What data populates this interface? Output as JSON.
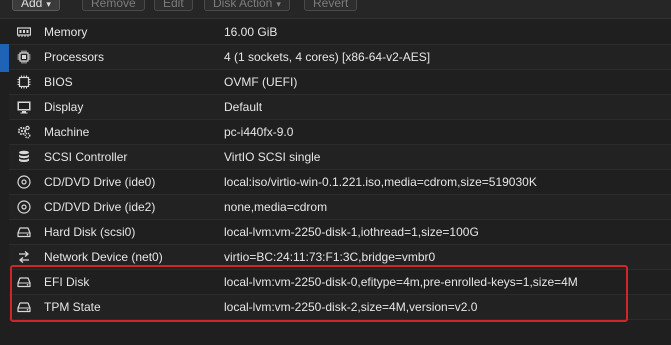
{
  "toolbar": {
    "buttons": [
      {
        "label": "Add",
        "enabled": true
      },
      {
        "label": "Remove",
        "enabled": false
      },
      {
        "label": "Edit",
        "enabled": false
      },
      {
        "label": "Disk Action",
        "enabled": false
      },
      {
        "label": "Revert",
        "enabled": false
      }
    ]
  },
  "hardware": {
    "rows": [
      {
        "icon": "memory-icon",
        "label": "Memory",
        "value": "16.00 GiB"
      },
      {
        "icon": "cpu-icon",
        "label": "Processors",
        "value": "4 (1 sockets, 4 cores) [x86-64-v2-AES]"
      },
      {
        "icon": "chip-icon",
        "label": "BIOS",
        "value": "OVMF (UEFI)"
      },
      {
        "icon": "monitor-icon",
        "label": "Display",
        "value": "Default"
      },
      {
        "icon": "gears-icon",
        "label": "Machine",
        "value": "pc-i440fx-9.0"
      },
      {
        "icon": "database-icon",
        "label": "SCSI Controller",
        "value": "VirtIO SCSI single"
      },
      {
        "icon": "disc-icon",
        "label": "CD/DVD Drive (ide0)",
        "value": "local:iso/virtio-win-0.1.221.iso,media=cdrom,size=519030K"
      },
      {
        "icon": "disc-icon",
        "label": "CD/DVD Drive (ide2)",
        "value": "none,media=cdrom"
      },
      {
        "icon": "hdd-icon",
        "label": "Hard Disk (scsi0)",
        "value": "local-lvm:vm-2250-disk-1,iothread=1,size=100G"
      },
      {
        "icon": "network-icon",
        "label": "Network Device (net0)",
        "value": "virtio=BC:24:11:73:F1:3C,bridge=vmbr0"
      },
      {
        "icon": "hdd-icon",
        "label": "EFI Disk",
        "value": "local-lvm:vm-2250-disk-0,efitype=4m,pre-enrolled-keys=1,size=4M"
      },
      {
        "icon": "hdd-icon",
        "label": "TPM State",
        "value": "local-lvm:vm-2250-disk-2,size=4M,version=v2.0"
      }
    ]
  },
  "colors": {
    "highlight": "#d0262b",
    "selection_accent": "#1e63b5"
  }
}
